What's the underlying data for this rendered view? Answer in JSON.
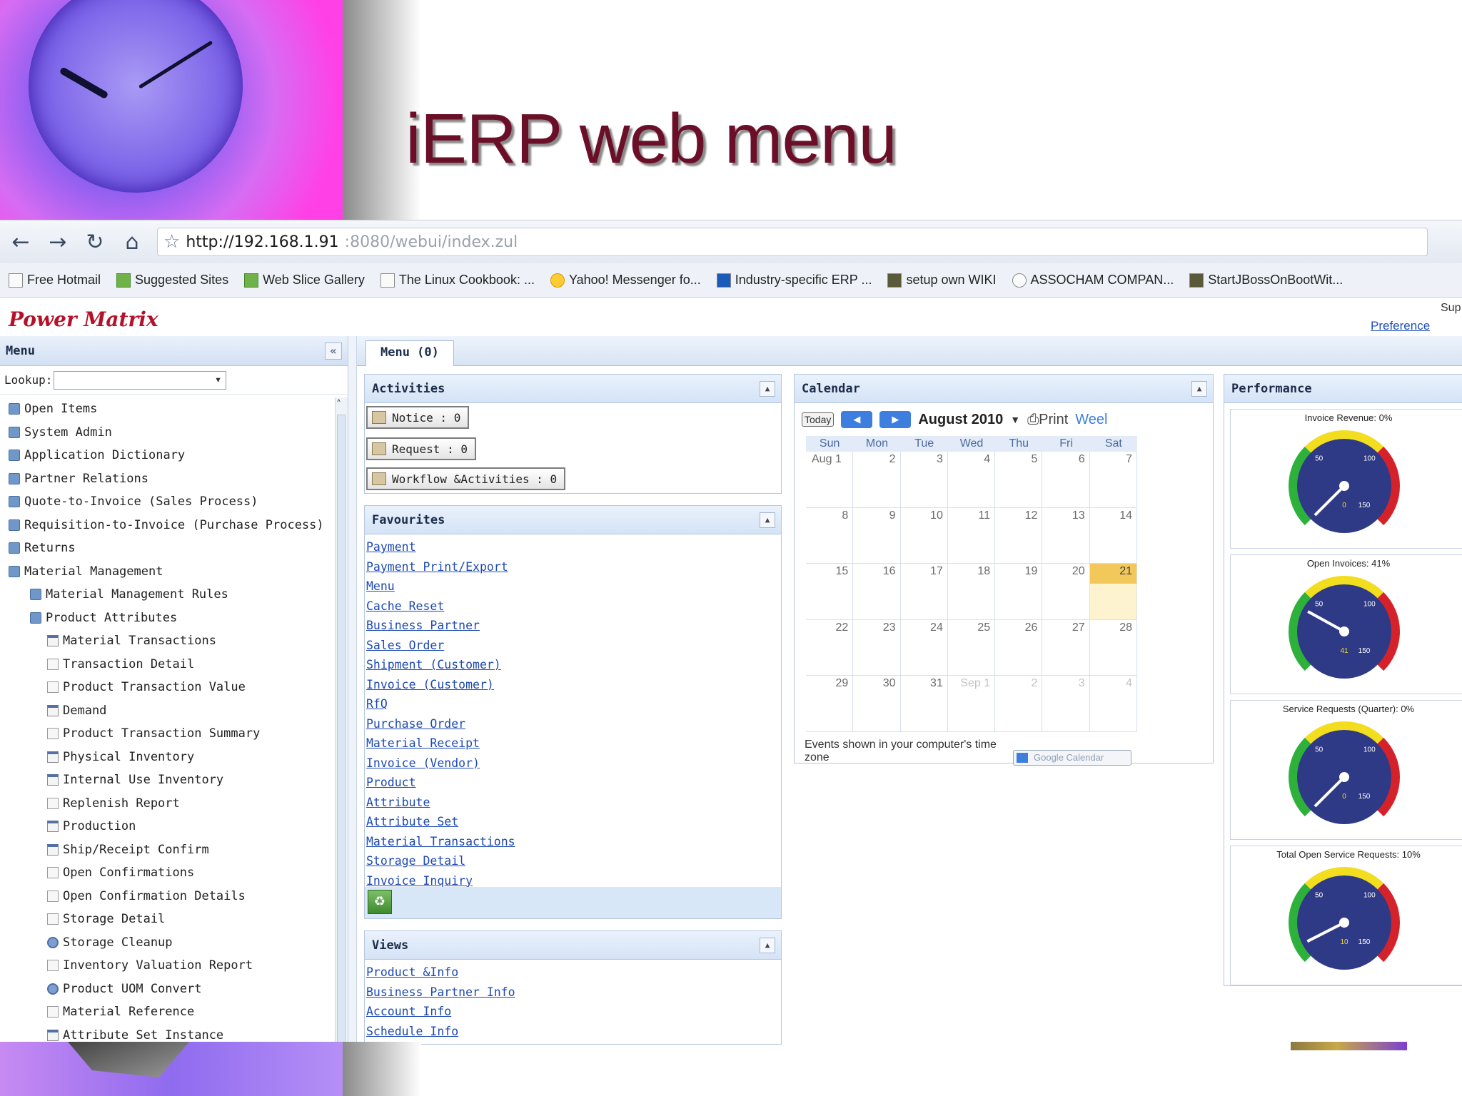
{
  "slide": {
    "title": "iERP web menu"
  },
  "browser": {
    "url_main": "http://192.168.1.91",
    "url_tail": ":8080/webui/index.zul",
    "bookmarks": [
      {
        "label": "Free Hotmail",
        "icon": "page-icon"
      },
      {
        "label": "Suggested Sites",
        "icon": "ie-icon"
      },
      {
        "label": "Web Slice Gallery",
        "icon": "web-slice-icon"
      },
      {
        "label": "The Linux Cookbook: ...",
        "icon": "page-icon"
      },
      {
        "label": "Yahoo! Messenger fo...",
        "icon": "yahoo-smiley-icon"
      },
      {
        "label": "Industry-specific ERP ...",
        "icon": "erp-site-icon"
      },
      {
        "label": "setup own WIKI",
        "icon": "wiki-icon"
      },
      {
        "label": "ASSOCHAM COMPAN...",
        "icon": "wordpress-icon"
      },
      {
        "label": "StartJBossOnBootWit...",
        "icon": "jboss-icon"
      }
    ]
  },
  "app": {
    "brand": "Power Matrix",
    "preference_link": "Preference",
    "sup_text": "Sup"
  },
  "menu_panel": {
    "title": "Menu",
    "lookup_label": "Lookup:",
    "lookup_value": "",
    "items": [
      {
        "label": "Open Items",
        "level": 0,
        "icon": "folder"
      },
      {
        "label": "System Admin",
        "level": 0,
        "icon": "folder"
      },
      {
        "label": "Application Dictionary",
        "level": 0,
        "icon": "folder"
      },
      {
        "label": "Partner Relations",
        "level": 0,
        "icon": "folder"
      },
      {
        "label": "Quote-to-Invoice (Sales Process)",
        "level": 0,
        "icon": "folder"
      },
      {
        "label": "Requisition-to-Invoice (Purchase Process)",
        "level": 0,
        "icon": "folder"
      },
      {
        "label": "Returns",
        "level": 0,
        "icon": "folder"
      },
      {
        "label": "Material Management",
        "level": 0,
        "icon": "folder"
      },
      {
        "label": "Material Management Rules",
        "level": 1,
        "icon": "folder"
      },
      {
        "label": "Product Attributes",
        "level": 1,
        "icon": "folder"
      },
      {
        "label": "Material Transactions",
        "level": 2,
        "icon": "window"
      },
      {
        "label": "Transaction Detail",
        "level": 2,
        "icon": "report"
      },
      {
        "label": "Product Transaction Value",
        "level": 2,
        "icon": "report"
      },
      {
        "label": "Demand",
        "level": 2,
        "icon": "window"
      },
      {
        "label": "Product Transaction Summary",
        "level": 2,
        "icon": "report"
      },
      {
        "label": "Physical Inventory",
        "level": 2,
        "icon": "window"
      },
      {
        "label": "Internal Use Inventory",
        "level": 2,
        "icon": "window"
      },
      {
        "label": "Replenish Report",
        "level": 2,
        "icon": "report"
      },
      {
        "label": "Production",
        "level": 2,
        "icon": "window"
      },
      {
        "label": "Ship/Receipt Confirm",
        "level": 2,
        "icon": "window"
      },
      {
        "label": "Open Confirmations",
        "level": 2,
        "icon": "report"
      },
      {
        "label": "Open Confirmation Details",
        "level": 2,
        "icon": "report"
      },
      {
        "label": "Storage Detail",
        "level": 2,
        "icon": "report"
      },
      {
        "label": "Storage Cleanup",
        "level": 2,
        "icon": "process"
      },
      {
        "label": "Inventory Valuation Report",
        "level": 2,
        "icon": "report"
      },
      {
        "label": "Product UOM Convert",
        "level": 2,
        "icon": "process"
      },
      {
        "label": "Material Reference",
        "level": 2,
        "icon": "report"
      },
      {
        "label": "Attribute Set Instance",
        "level": 2,
        "icon": "window"
      }
    ]
  },
  "tabs": {
    "menu_tab": "Menu (0)"
  },
  "activities": {
    "title": "Activities",
    "notice": "Notice : 0",
    "request": "Request : 0",
    "workflow": "Workflow &Activities : 0"
  },
  "favourites": {
    "title": "Favourites",
    "links": [
      "Payment",
      "Payment Print/Export",
      "Menu",
      "Cache Reset",
      "Business Partner",
      "Sales Order",
      "Shipment (Customer)",
      "Invoice (Customer)",
      "RfQ",
      "Purchase Order",
      "Material Receipt",
      "Invoice (Vendor)",
      "Product",
      "Attribute",
      "Attribute Set",
      "Material Transactions",
      "Storage Detail",
      "Invoice Inquiry"
    ]
  },
  "views": {
    "title": "Views",
    "links": [
      "Product &Info",
      "Business Partner Info",
      "Account Info",
      "Schedule Info"
    ]
  },
  "calendar": {
    "title": "Calendar",
    "today_label": "Today",
    "month_label": "August 2010",
    "print_label": "Print",
    "week_label": "Weel",
    "day_names": [
      "Sun",
      "Mon",
      "Tue",
      "Wed",
      "Thu",
      "Fri",
      "Sat"
    ],
    "days": [
      {
        "label": "Aug 1",
        "other": false,
        "today": false
      },
      {
        "label": "2",
        "other": false,
        "today": false
      },
      {
        "label": "3",
        "other": false,
        "today": false
      },
      {
        "label": "4",
        "other": false,
        "today": false
      },
      {
        "label": "5",
        "other": false,
        "today": false
      },
      {
        "label": "6",
        "other": false,
        "today": false
      },
      {
        "label": "7",
        "other": false,
        "today": false
      },
      {
        "label": "8",
        "other": false,
        "today": false
      },
      {
        "label": "9",
        "other": false,
        "today": false
      },
      {
        "label": "10",
        "other": false,
        "today": false
      },
      {
        "label": "11",
        "other": false,
        "today": false
      },
      {
        "label": "12",
        "other": false,
        "today": false
      },
      {
        "label": "13",
        "other": false,
        "today": false
      },
      {
        "label": "14",
        "other": false,
        "today": false
      },
      {
        "label": "15",
        "other": false,
        "today": false
      },
      {
        "label": "16",
        "other": false,
        "today": false
      },
      {
        "label": "17",
        "other": false,
        "today": false
      },
      {
        "label": "18",
        "other": false,
        "today": false
      },
      {
        "label": "19",
        "other": false,
        "today": false
      },
      {
        "label": "20",
        "other": false,
        "today": false
      },
      {
        "label": "21",
        "other": false,
        "today": true
      },
      {
        "label": "22",
        "other": false,
        "today": false
      },
      {
        "label": "23",
        "other": false,
        "today": false
      },
      {
        "label": "24",
        "other": false,
        "today": false
      },
      {
        "label": "25",
        "other": false,
        "today": false
      },
      {
        "label": "26",
        "other": false,
        "today": false
      },
      {
        "label": "27",
        "other": false,
        "today": false
      },
      {
        "label": "28",
        "other": false,
        "today": false
      },
      {
        "label": "29",
        "other": false,
        "today": false
      },
      {
        "label": "30",
        "other": false,
        "today": false
      },
      {
        "label": "31",
        "other": false,
        "today": false
      },
      {
        "label": "Sep 1",
        "other": true,
        "today": false
      },
      {
        "label": "2",
        "other": true,
        "today": false
      },
      {
        "label": "3",
        "other": true,
        "today": false
      },
      {
        "label": "4",
        "other": true,
        "today": false
      }
    ],
    "footnote": "Events shown in your computer's time zone",
    "google_button": "Google Calendar"
  },
  "performance": {
    "title": "Performance",
    "gauges": [
      {
        "title": "Invoice Revenue: 0%",
        "value": 0,
        "max": 150,
        "readout": "0"
      },
      {
        "title": "Open Invoices: 41%",
        "value": 41,
        "max": 150,
        "readout": "41"
      },
      {
        "title": "Service Requests (Quarter): 0%",
        "value": 0,
        "max": 150,
        "readout": "0"
      },
      {
        "title": "Total Open Service Requests: 10%",
        "value": 10,
        "max": 150,
        "readout": "10"
      }
    ],
    "tick_labels": [
      "50",
      "100",
      "150"
    ]
  },
  "colors": {
    "title_text": "#6b0f29",
    "brand": "#b3122a",
    "link": "#1d49b3",
    "gauge_face": "#2f3a86"
  }
}
